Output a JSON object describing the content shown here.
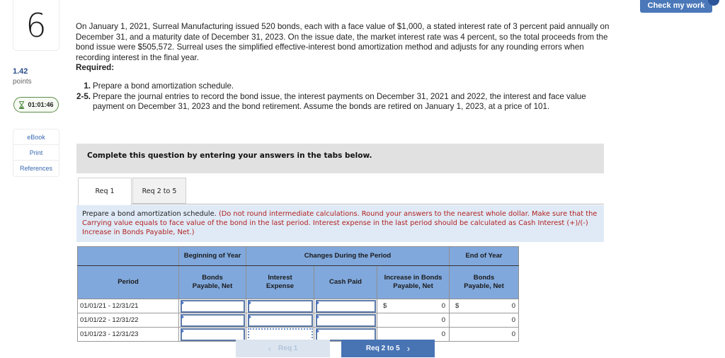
{
  "question": {
    "number": "6",
    "points_value": "1.42",
    "points_label": "points",
    "timer": "01:01:46",
    "text": "On January 1, 2021, Surreal Manufacturing issued 520 bonds, each with a face value of $1,000, a stated interest rate of 3 percent paid annually on December 31, and a maturity date of December 31, 2023. On the issue date, the market interest rate was 4 percent, so the total proceeds from the bond issue were $505,572. Surreal uses the simplified effective-interest bond amortization method and adjusts for any rounding errors when recording interest in the final year.",
    "required_label": "Required:",
    "requirements": [
      {
        "num": "1.",
        "text": "Prepare a bond amortization schedule."
      },
      {
        "num": "2-5.",
        "text": "Prepare the journal entries to record the bond issue, the interest payments on December 31, 2021 and 2022, the interest and face value payment on December 31, 2023 and the bond retirement. Assume the bonds are retired on January 1, 2023, at a price of 101."
      }
    ]
  },
  "resources": [
    "eBook",
    "Print",
    "References"
  ],
  "check_button": "Check my work",
  "complete_instruction": "Complete this question by entering your answers in the tabs below.",
  "tabs": [
    {
      "label": "Req 1",
      "active": true
    },
    {
      "label": "Req 2 to 5",
      "active": false
    }
  ],
  "instruction": {
    "main": "Prepare a bond amortization schedule.",
    "note": "(Do not round intermediate calculations. Round your answers to the nearest whole dollar. Make sure that the Carrying value equals to face value of the bond in the last period. Interest expense in the last period should be calculated as Cash Interest (+)/(-) Increase in Bonds Payable, Net.)"
  },
  "table": {
    "group_headers": {
      "beginning": "Beginning of Year",
      "changes": "Changes During the Period",
      "end": "End of Year"
    },
    "columns": {
      "period": "Period",
      "bonds_payable_beg": "Bonds Payable, Net",
      "interest_expense": "Interest Expense",
      "cash_paid": "Cash Paid",
      "increase": "Increase in Bonds Payable, Net",
      "bonds_payable_end": "Bonds Payable, Net"
    },
    "rows": [
      {
        "period": "01/01/21 - 12/31/21",
        "bonds_payable_beg": "",
        "interest_expense": "",
        "cash_paid": "",
        "increase_prefix": "$",
        "increase": "0",
        "end_prefix": "$",
        "bonds_payable_end": "0"
      },
      {
        "period": "01/01/22 - 12/31/22",
        "bonds_payable_beg": "",
        "interest_expense": "",
        "cash_paid": "",
        "increase_prefix": "",
        "increase": "0",
        "end_prefix": "",
        "bonds_payable_end": "0"
      },
      {
        "period": "01/01/23 - 12/31/23",
        "bonds_payable_beg": "",
        "interest_expense": "",
        "cash_paid": "",
        "increase_prefix": "",
        "increase": "0",
        "end_prefix": "",
        "bonds_payable_end": "0"
      }
    ]
  },
  "nav": {
    "prev_label": "Req 1",
    "prev_icon": "‹",
    "next_label": "Req 2 to 5",
    "next_icon": "›"
  }
}
